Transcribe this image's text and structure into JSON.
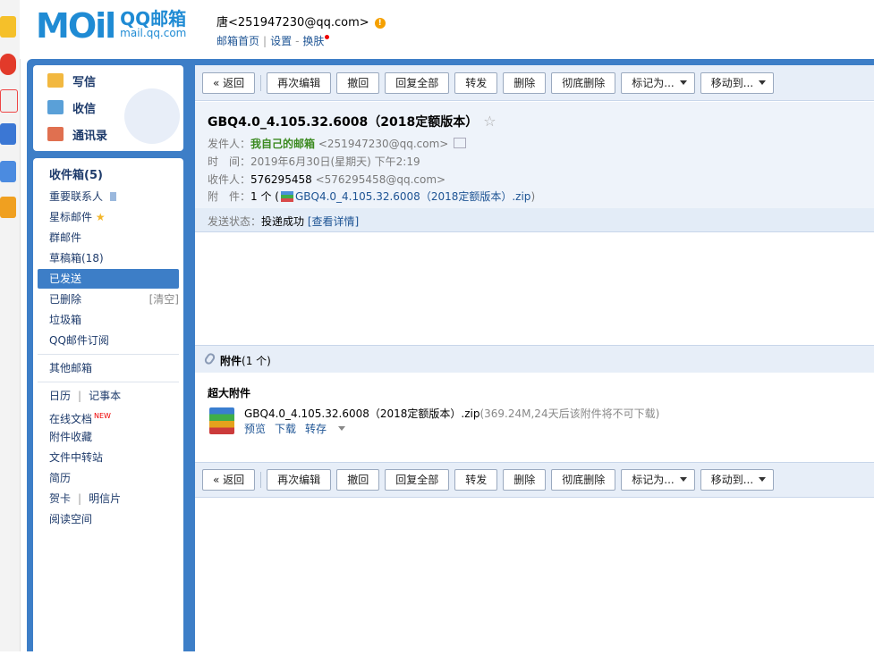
{
  "header": {
    "logo_word": "MOil",
    "logo_cn": "QQ邮箱",
    "logo_en": "mail.qq.com",
    "user": "唐<251947230@qq.com>",
    "link_home": "邮箱首页",
    "link_settings": "设置",
    "link_skin": "换肤",
    "sep": "|",
    "dash": "-"
  },
  "sidebar": {
    "compose": "写信",
    "receive": "收信",
    "contacts": "通讯录",
    "folders": [
      {
        "label": "收件箱(5)"
      },
      {
        "label": "重要联系人"
      },
      {
        "label": "星标邮件"
      },
      {
        "label": "群邮件"
      },
      {
        "label": "草稿箱(18)"
      },
      {
        "label": "已发送"
      },
      {
        "label": "已删除"
      },
      {
        "label": "垃圾箱"
      },
      {
        "label": "QQ邮件订阅"
      },
      {
        "label": "其他邮箱"
      },
      {
        "label": "日历"
      },
      {
        "label": "记事本"
      },
      {
        "label": "在线文档"
      },
      {
        "label": "附件收藏"
      },
      {
        "label": "文件中转站"
      },
      {
        "label": "简历"
      },
      {
        "label": "贺卡"
      },
      {
        "label": "明信片"
      },
      {
        "label": "阅读空间"
      }
    ],
    "clear_label": "[清空]",
    "new_badge": "NEW",
    "pipe": "|"
  },
  "toolbar": {
    "back": "« 返回",
    "re_edit": "再次编辑",
    "recall": "撤回",
    "reply_all": "回复全部",
    "forward": "转发",
    "delete": "删除",
    "delete_forever": "彻底删除",
    "mark_as": "标记为...",
    "move_to": "移动到..."
  },
  "mail": {
    "subject": "GBQ4.0_4.105.32.6008（2018定额版本）",
    "from_label": "发件人：",
    "from_name": "我自己的邮箱",
    "from_addr": "<251947230@qq.com>",
    "time_label": "时　间：",
    "time_value": "2019年6月30日(星期天) 下午2:19",
    "to_label": "收件人：",
    "to_name": "576295458",
    "to_addr": "<576295458@qq.com>",
    "att_label": "附　件：",
    "att_count": "1 个 (",
    "att_name": "GBQ4.0_4.105.32.6008（2018定额版本）.zip",
    "att_close": ")",
    "status_label": "发送状态：",
    "status_value": "投递成功",
    "status_detail": "[查看详情]"
  },
  "attachments": {
    "bar_title": "附件",
    "bar_count": "(1 个)",
    "section_title": "超大附件",
    "file_name": "GBQ4.0_4.105.32.6008（2018定额版本）.zip",
    "file_info": "(369.24M,24天后该附件将不可下载)",
    "preview": "预览",
    "download": "下载",
    "save": "转存"
  }
}
